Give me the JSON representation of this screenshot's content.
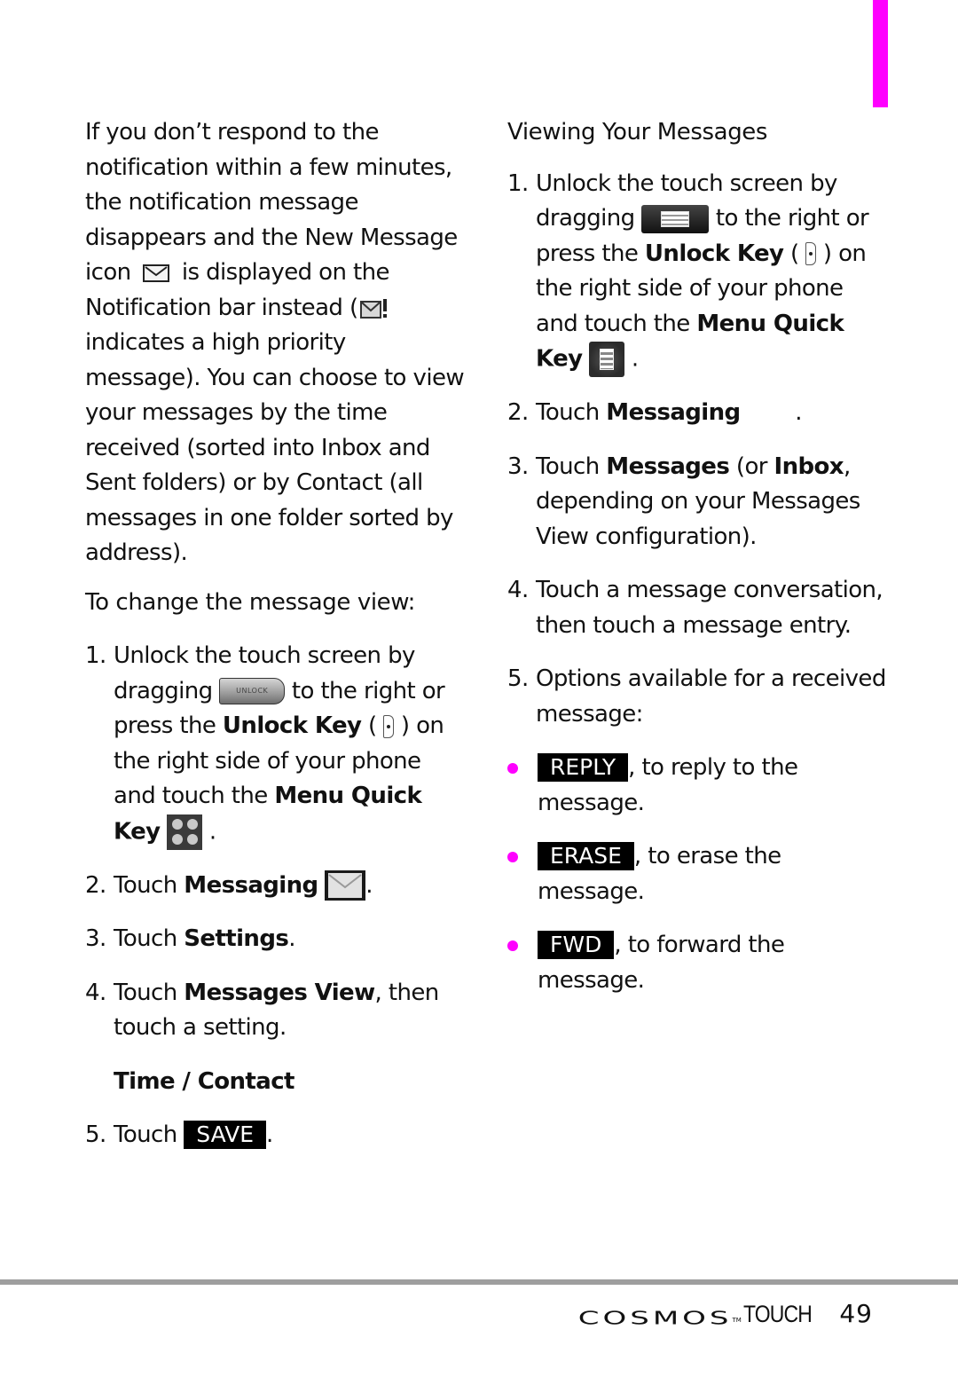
{
  "page": {
    "accent_color": "#ff00ff",
    "page_number": "49",
    "brand": {
      "logo": "COSMOS",
      "trademark": "TM",
      "suffix": "TOUCH"
    }
  },
  "left": {
    "intro": {
      "part1": "If you don’t respond to the notification within a few minutes, the notification message disappears and the New Message icon",
      "part2": "is displayed on the Notification bar instead (",
      "part3": "indicates a high priority message). You can choose to view your messages by the time received (sorted into Inbox and Sent folders) or by Contact (all messages in one folder sorted by address)."
    },
    "heading": "To change the message view:",
    "steps": [
      {
        "num": "1.",
        "t1": "Unlock the touch screen by dragging",
        "slider_label": "UNLOCK",
        "t2": "to the right or press the",
        "b1": "Unlock Key",
        "t3": "(",
        "t4": ") on the right side of your phone and touch the",
        "b2": "Menu Quick Key",
        "t5": "."
      },
      {
        "num": "2.",
        "t1": "Touch",
        "b1": "Messaging",
        "t2": "."
      },
      {
        "num": "3.",
        "t1": "Touch",
        "b1": "Settings",
        "t2": "."
      },
      {
        "num": "4.",
        "t1": "Touch",
        "b1": "Messages View",
        "t2": ", then touch a setting."
      },
      {
        "num": "5.",
        "t1": "Touch",
        "key": "SAVE",
        "t2": "."
      }
    ],
    "setting_options": "Time / Contact"
  },
  "right": {
    "heading": "Viewing Your Messages",
    "steps": [
      {
        "num": "1.",
        "t1": "Unlock the touch screen by dragging",
        "t2": "to the right or press the",
        "b1": "Unlock Key",
        "t3": "(",
        "t4": ") on the right side of your phone and touch the",
        "b2": "Menu Quick Key",
        "t5": "."
      },
      {
        "num": "2.",
        "t1": "Touch",
        "b1": "Messaging",
        "t2": "."
      },
      {
        "num": "3.",
        "t1": "Touch",
        "b1": "Messages",
        "t2": "(or",
        "b2": "Inbox",
        "t3": ", depending on your Messages View configuration)."
      },
      {
        "num": "4.",
        "t1": "Touch a message conversation, then touch a message entry."
      },
      {
        "num": "5.",
        "t1": "Options available for a received message:"
      }
    ],
    "options": [
      {
        "key": "REPLY",
        "text": ", to reply to the message."
      },
      {
        "key": "ERASE",
        "text": ", to erase the message."
      },
      {
        "key": "FWD",
        "text": ", to forward the message."
      }
    ]
  }
}
